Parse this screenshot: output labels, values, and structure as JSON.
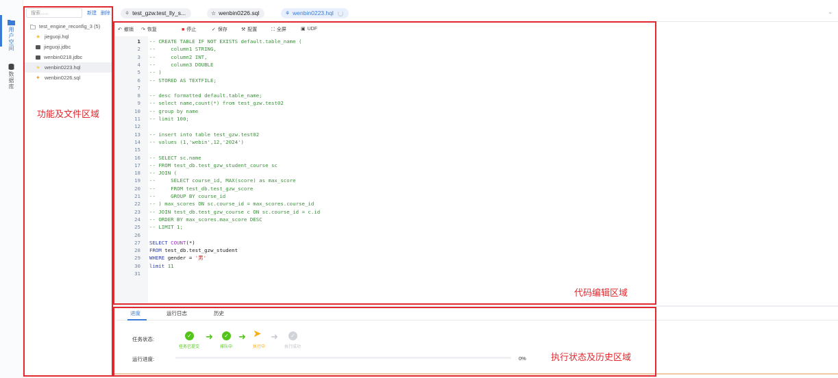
{
  "rail": {
    "items": [
      {
        "label": "用户空间",
        "icon": "folder-icon",
        "active": true
      },
      {
        "label": "数据库",
        "icon": "database-icon",
        "active": false
      }
    ]
  },
  "file_panel": {
    "search_placeholder": "搜索......",
    "new_label": "新建",
    "delete_label": "删除",
    "folder": "test_engine_reconfig_3 (5)",
    "files": [
      {
        "name": "jieguoji.hql",
        "icon": "hql-file-icon",
        "selected": false
      },
      {
        "name": "jieguoji.jdbc",
        "icon": "jdbc-file-icon",
        "selected": false
      },
      {
        "name": "wenbin0218.jdbc",
        "icon": "jdbc-file-icon",
        "selected": false
      },
      {
        "name": "wenbin0223.hql",
        "icon": "hql-file-icon",
        "selected": true
      },
      {
        "name": "wenbin0226.sql",
        "icon": "sql-file-icon",
        "selected": false
      }
    ]
  },
  "tabs": [
    {
      "label": "test_gzw.test_lly_s...",
      "icon": "hql-file-icon",
      "active": false
    },
    {
      "label": "wenbin0226.sql",
      "icon": "sql-file-icon",
      "active": false
    },
    {
      "label": "wenbin0223.hql",
      "icon": "hql-file-icon",
      "active": true
    }
  ],
  "toolbar": {
    "undo": "撤销",
    "redo": "恢复",
    "stop": "停止",
    "save": "保存",
    "config": "配置",
    "fullscreen": "全屏",
    "udf": "UDF"
  },
  "code_lines": [
    [
      [
        "cm",
        "-- CREATE TABLE IF NOT EXISTS default.table_name ("
      ]
    ],
    [
      [
        "cm",
        "--     column1 STRING,"
      ]
    ],
    [
      [
        "cm",
        "--     column2 INT,"
      ]
    ],
    [
      [
        "cm",
        "--     column3 DOUBLE"
      ]
    ],
    [
      [
        "cm",
        "-- )"
      ]
    ],
    [
      [
        "cm",
        "-- STORED AS TEXTFILE;"
      ]
    ],
    [],
    [
      [
        "cm",
        "-- desc formatted default.table_name;"
      ]
    ],
    [
      [
        "cm",
        "-- select name,count(*) from test_gzw.test02"
      ]
    ],
    [
      [
        "cm",
        "-- group by name"
      ]
    ],
    [
      [
        "cm",
        "-- limit 100;"
      ]
    ],
    [],
    [
      [
        "cm",
        "-- insert into table test_gzw.test02"
      ]
    ],
    [
      [
        "cm",
        "-- values (1,'webin',12,'2024')"
      ]
    ],
    [],
    [
      [
        "cm",
        "-- SELECT sc.name"
      ]
    ],
    [
      [
        "cm",
        "-- FROM test_db.test_gzw_student_course sc"
      ]
    ],
    [
      [
        "cm",
        "-- JOIN ("
      ]
    ],
    [
      [
        "cm",
        "--     SELECT course_id, MAX(score) as max_score"
      ]
    ],
    [
      [
        "cm",
        "--     FROM test_db.test_gzw_score"
      ]
    ],
    [
      [
        "cm",
        "--     GROUP BY course_id"
      ]
    ],
    [
      [
        "cm",
        "-- ) max_scores ON sc.course_id = max_scores.course_id"
      ]
    ],
    [
      [
        "cm",
        "-- JOIN test_db.test_gzw_course c ON sc.course_id = c.id"
      ]
    ],
    [
      [
        "cm",
        "-- ORDER BY max_scores.max_score DESC"
      ]
    ],
    [
      [
        "cm",
        "-- LIMIT 1;"
      ]
    ],
    [],
    [
      [
        "kw",
        "SELECT "
      ],
      [
        "fn",
        "COUNT"
      ],
      [
        "plain",
        "(*)"
      ]
    ],
    [
      [
        "kw",
        "FROM "
      ],
      [
        "plain",
        "test_db.test_gzw_student"
      ]
    ],
    [
      [
        "kw",
        "WHERE "
      ],
      [
        "plain",
        "gender = "
      ],
      [
        "str",
        "'男'"
      ]
    ],
    [
      [
        "kw",
        "limit "
      ],
      [
        "num",
        "11"
      ]
    ],
    []
  ],
  "bottom_panel": {
    "tabs": [
      "进度",
      "运行日志",
      "历史"
    ],
    "task_status_label": "任务状态:",
    "progress_label": "运行进度:",
    "steps": [
      {
        "label": "任务已提交",
        "state": "done"
      },
      {
        "label": "排队中",
        "state": "done"
      },
      {
        "label": "执行中",
        "state": "running"
      },
      {
        "label": "执行成功",
        "state": "pending"
      }
    ],
    "progress_percent": 0,
    "progress_text": "0%"
  },
  "annotations": {
    "files_area": "功能及文件区域",
    "editor_area": "代码编辑区域",
    "status_area": "执行状态及历史区域"
  },
  "colors": {
    "accent": "#3a7bd5",
    "annotation_red": "#e0282e",
    "done_green": "#52c41a",
    "running_orange": "#faad14",
    "pending_gray": "#d0d3d8"
  }
}
